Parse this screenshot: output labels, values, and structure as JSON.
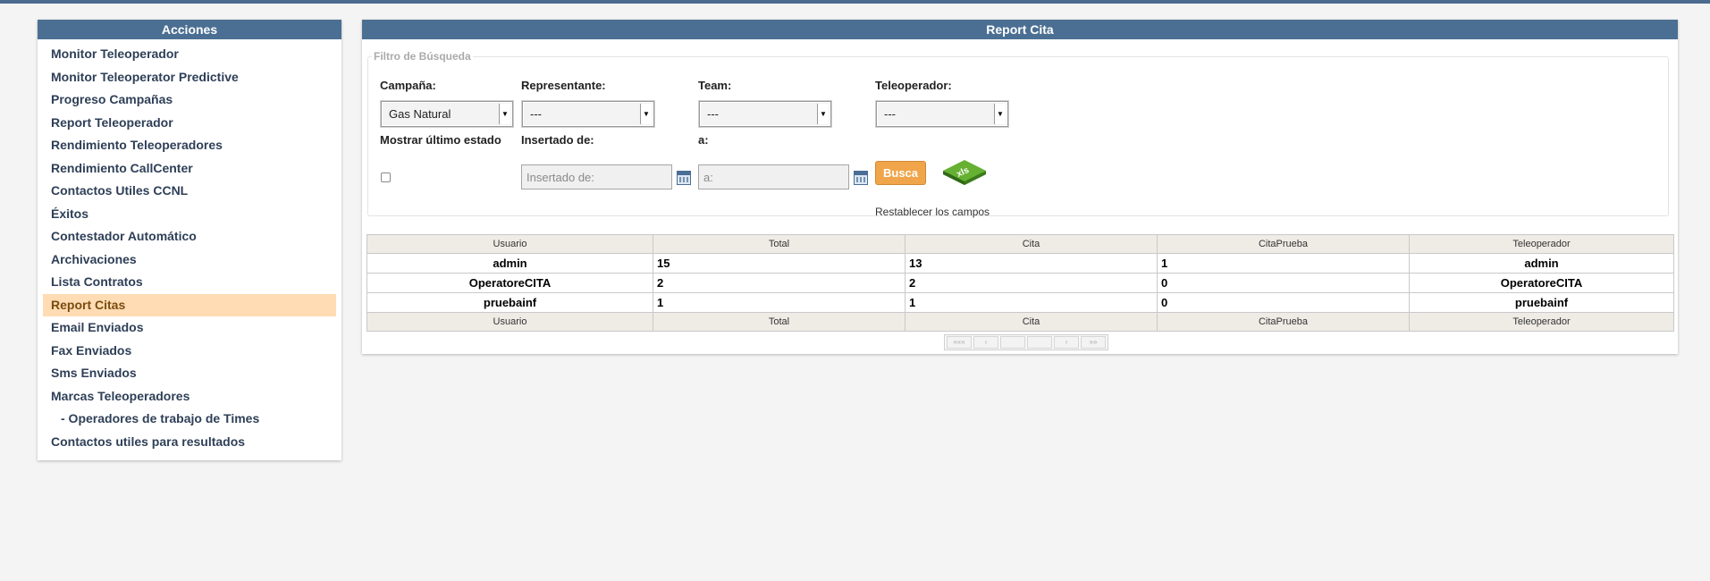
{
  "sidebar": {
    "title": "Acciones",
    "items": [
      {
        "label": "Monitor Teleoperador"
      },
      {
        "label": "Monitor Teleoperator Predictive"
      },
      {
        "label": "Progreso Campañas"
      },
      {
        "label": "Report Teleoperador"
      },
      {
        "label": "Rendimiento Teleoperadores"
      },
      {
        "label": "Rendimiento CallCenter"
      },
      {
        "label": "Contactos Utiles CCNL"
      },
      {
        "label": "Éxitos"
      },
      {
        "label": "Contestador Automático"
      },
      {
        "label": "Archivaciones"
      },
      {
        "label": "Lista Contratos"
      },
      {
        "label": "Report Citas"
      },
      {
        "label": "Email Enviados"
      },
      {
        "label": "Fax Enviados"
      },
      {
        "label": "Sms Enviados"
      },
      {
        "label": "Marcas Teleoperadores"
      },
      {
        "label": "- Operadores de trabajo de Times"
      },
      {
        "label": "Contactos utiles para resultados"
      }
    ]
  },
  "main": {
    "title": "Report Cita",
    "filter": {
      "legend": "Filtro de Búsqueda",
      "campana_label": "Campaña:",
      "campana_value": "Gas Natural",
      "representante_label": "Representante:",
      "representante_value": "---",
      "team_label": "Team:",
      "team_value": "---",
      "teleoperador_label": "Teleoperador:",
      "teleoperador_value": "---",
      "mostrar_label": "Mostrar último estado",
      "insertado_label": "Insertado de:",
      "insertado_placeholder": "Insertado de:",
      "a_label": "a:",
      "a_placeholder": "a:",
      "busca_label": "Busca",
      "xls_label": "xls",
      "reset_label": "Restablecer los campos"
    },
    "table": {
      "headers": [
        "Usuario",
        "Total",
        "Cita",
        "CitaPrueba",
        "Teleoperador"
      ],
      "rows": [
        [
          "admin",
          "15",
          "13",
          "1",
          "admin"
        ],
        [
          "OperatoreCITA",
          "2",
          "2",
          "0",
          "OperatoreCITA"
        ],
        [
          "pruebainf",
          "1",
          "1",
          "0",
          "pruebainf"
        ]
      ],
      "footer": [
        "Usuario",
        "Total",
        "Cita",
        "CitaPrueba",
        "Teleoperador"
      ]
    },
    "pager": {
      "first": "«««",
      "prev": "‹",
      "next": "›",
      "last": "»»"
    }
  },
  "colors": {
    "header": "#4b6f93",
    "active_item": "#ffdcb3",
    "button": "#f0a54a"
  }
}
